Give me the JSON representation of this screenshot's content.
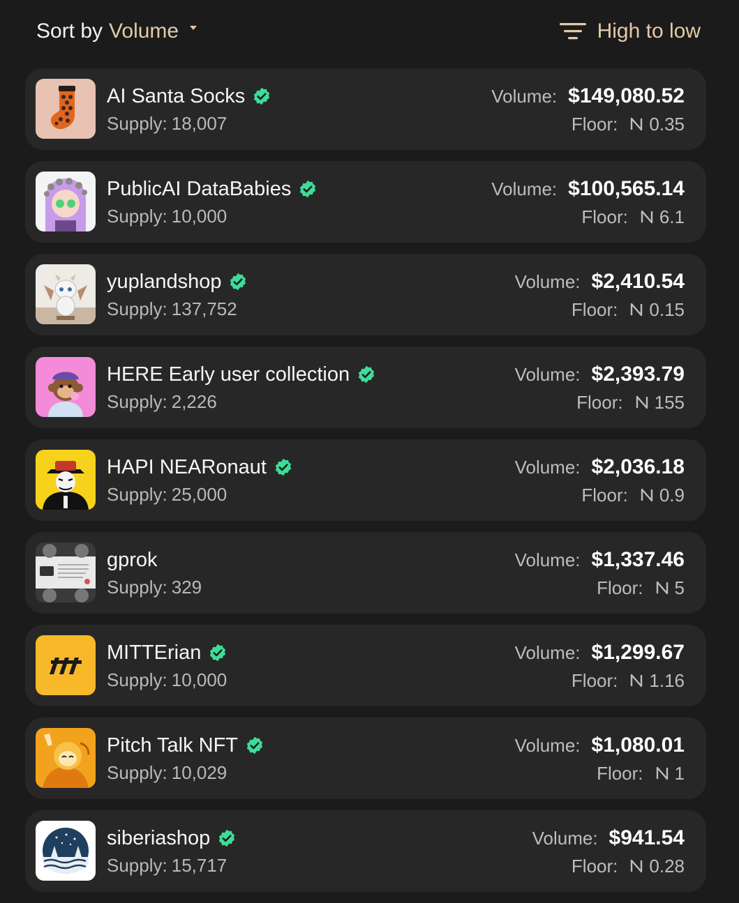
{
  "sort": {
    "prefix": "Sort by",
    "value": "Volume",
    "order_label": "High to low"
  },
  "labels": {
    "supply": "Supply:",
    "volume": "Volume:",
    "floor": "Floor:"
  },
  "colors": {
    "accent": "#e6c9a8",
    "verified": "#3ddc97",
    "row_bg": "#272728",
    "page_bg": "#1b1b1c"
  },
  "collections": [
    {
      "name": "AI Santa Socks",
      "verified": true,
      "supply": "18,007",
      "volume": "$149,080.52",
      "floor": "0.35",
      "thumb": "santa-socks-thumbnail"
    },
    {
      "name": "PublicAI DataBabies",
      "verified": true,
      "supply": "10,000",
      "volume": "$100,565.14",
      "floor": "6.1",
      "thumb": "datababies-thumbnail"
    },
    {
      "name": "yuplandshop",
      "verified": true,
      "supply": "137,752",
      "volume": "$2,410.54",
      "floor": "0.15",
      "thumb": "yupland-dragon-thumbnail"
    },
    {
      "name": "HERE Early user collection",
      "verified": true,
      "supply": "2,226",
      "volume": "$2,393.79",
      "floor": "155",
      "thumb": "here-monkey-thumbnail"
    },
    {
      "name": "HAPI NEARonaut",
      "verified": true,
      "supply": "25,000",
      "volume": "$2,036.18",
      "floor": "0.9",
      "thumb": "hapi-nearonaut-thumbnail"
    },
    {
      "name": "gprok",
      "verified": false,
      "supply": "329",
      "volume": "$1,337.46",
      "floor": "5",
      "thumb": "gprok-banknote-thumbnail"
    },
    {
      "name": "MITTErian",
      "verified": true,
      "supply": "10,000",
      "volume": "$1,299.67",
      "floor": "1.16",
      "thumb": "mitterian-logo-thumbnail"
    },
    {
      "name": "Pitch Talk NFT",
      "verified": true,
      "supply": "10,029",
      "volume": "$1,080.01",
      "floor": "1",
      "thumb": "pitch-talk-thumbnail"
    },
    {
      "name": "siberiashop",
      "verified": true,
      "supply": "15,717",
      "volume": "$941.54",
      "floor": "0.28",
      "thumb": "siberia-logo-thumbnail"
    }
  ]
}
